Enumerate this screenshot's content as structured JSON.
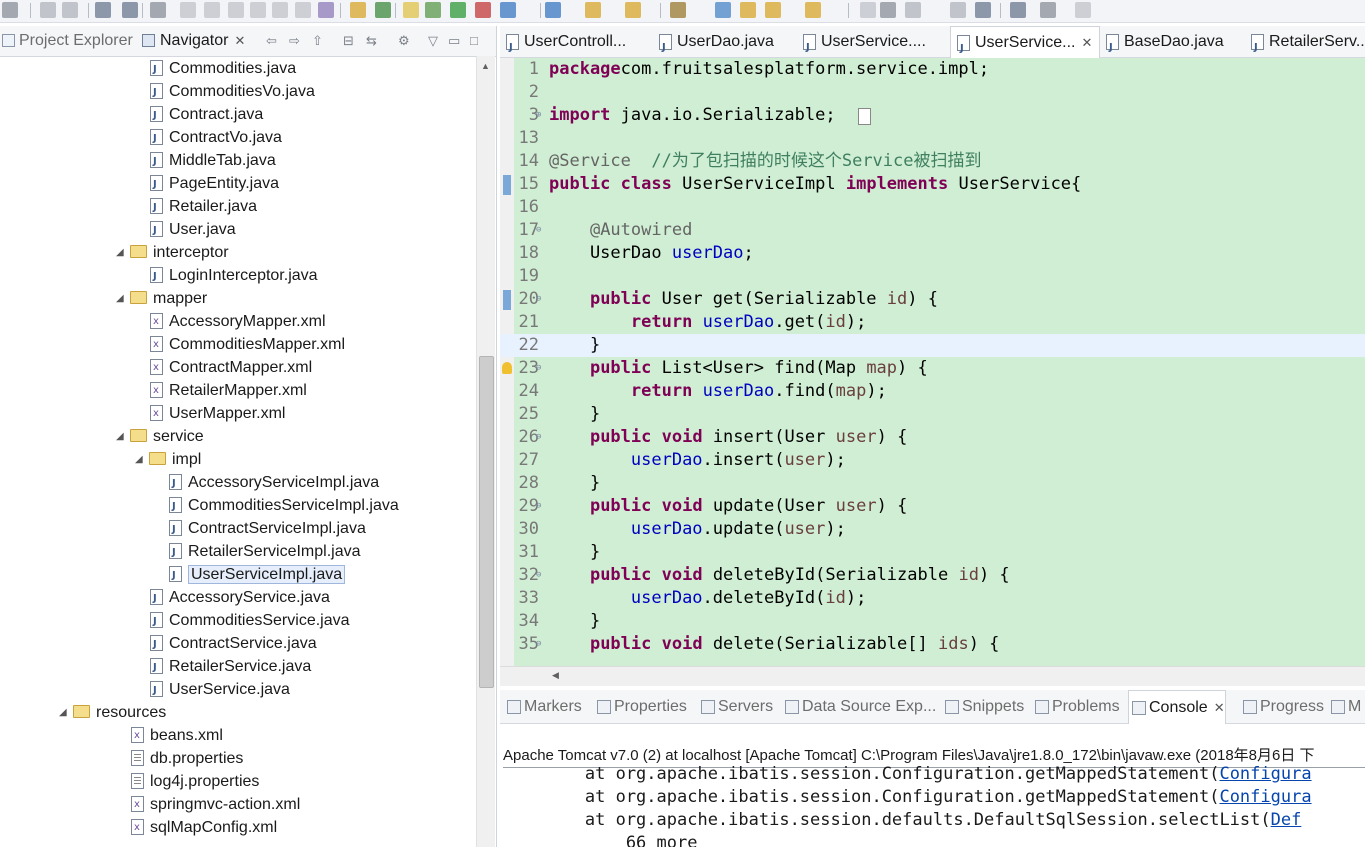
{
  "left_panel": {
    "tabs": [
      {
        "label": "Project Explorer",
        "active": false
      },
      {
        "label": "Navigator",
        "active": true
      }
    ],
    "tree": [
      {
        "label": "Commodities.java",
        "type": "java",
        "depth": 3
      },
      {
        "label": "CommoditiesVo.java",
        "type": "java",
        "depth": 3
      },
      {
        "label": "Contract.java",
        "type": "java",
        "depth": 3
      },
      {
        "label": "ContractVo.java",
        "type": "java",
        "depth": 3
      },
      {
        "label": "MiddleTab.java",
        "type": "java",
        "depth": 3
      },
      {
        "label": "PageEntity.java",
        "type": "java",
        "depth": 3
      },
      {
        "label": "Retailer.java",
        "type": "java",
        "depth": 3
      },
      {
        "label": "User.java",
        "type": "java",
        "depth": 3
      },
      {
        "label": "interceptor",
        "type": "folder",
        "depth": 2,
        "expanded": true
      },
      {
        "label": "LoginInterceptor.java",
        "type": "java",
        "depth": 3
      },
      {
        "label": "mapper",
        "type": "folder",
        "depth": 2,
        "expanded": true
      },
      {
        "label": "AccessoryMapper.xml",
        "type": "xml",
        "depth": 3
      },
      {
        "label": "CommoditiesMapper.xml",
        "type": "xml",
        "depth": 3
      },
      {
        "label": "ContractMapper.xml",
        "type": "xml",
        "depth": 3
      },
      {
        "label": "RetailerMapper.xml",
        "type": "xml",
        "depth": 3
      },
      {
        "label": "UserMapper.xml",
        "type": "xml",
        "depth": 3
      },
      {
        "label": "service",
        "type": "folder",
        "depth": 2,
        "expanded": true
      },
      {
        "label": "impl",
        "type": "folder",
        "depth": 3,
        "expanded": true
      },
      {
        "label": "AccessoryServiceImpl.java",
        "type": "java",
        "depth": 4
      },
      {
        "label": "CommoditiesServiceImpl.java",
        "type": "java",
        "depth": 4
      },
      {
        "label": "ContractServiceImpl.java",
        "type": "java",
        "depth": 4
      },
      {
        "label": "RetailerServiceImpl.java",
        "type": "java",
        "depth": 4
      },
      {
        "label": "UserServiceImpl.java",
        "type": "java",
        "depth": 4,
        "selected": true
      },
      {
        "label": "AccessoryService.java",
        "type": "java",
        "depth": 3
      },
      {
        "label": "CommoditiesService.java",
        "type": "java",
        "depth": 3
      },
      {
        "label": "ContractService.java",
        "type": "java",
        "depth": 3
      },
      {
        "label": "RetailerService.java",
        "type": "java",
        "depth": 3
      },
      {
        "label": "UserService.java",
        "type": "java",
        "depth": 3
      },
      {
        "label": "resources",
        "type": "folder",
        "depth": 1,
        "expanded": true
      },
      {
        "label": "beans.xml",
        "type": "xml",
        "depth": 2
      },
      {
        "label": "db.properties",
        "type": "props",
        "depth": 2
      },
      {
        "label": "log4j.properties",
        "type": "props",
        "depth": 2
      },
      {
        "label": "springmvc-action.xml",
        "type": "xml",
        "depth": 2
      },
      {
        "label": "sqlMapConfig.xml",
        "type": "xml",
        "depth": 2
      }
    ]
  },
  "editor": {
    "tabs": [
      {
        "label": "UserControll...",
        "active": false
      },
      {
        "label": "UserDao.java",
        "active": false
      },
      {
        "label": "UserService....",
        "active": false
      },
      {
        "label": "UserService...",
        "active": true
      },
      {
        "label": "BaseDao.java",
        "active": false
      },
      {
        "label": "RetailerServ...",
        "active": false
      }
    ],
    "lines": [
      {
        "n": "1",
        "parts": [
          [
            "kw",
            "package"
          ],
          [
            "",
            "com.fruitsalesplatform.service.impl;"
          ]
        ]
      },
      {
        "n": "2",
        "parts": []
      },
      {
        "n": "3",
        "fold": "+",
        "parts": [
          [
            "kw",
            "import"
          ],
          [
            "",
            " java.io.Serializable;"
          ]
        ]
      },
      {
        "n": "13",
        "parts": []
      },
      {
        "n": "14",
        "parts": [
          [
            "ann",
            "@Service"
          ],
          [
            "",
            "  "
          ],
          [
            "cmt",
            "//为了包扫描的时候这个Service被扫描到"
          ]
        ]
      },
      {
        "n": "15",
        "parts": [
          [
            "kw",
            "public"
          ],
          [
            "",
            ""
          ],
          [
            "kw",
            "class"
          ],
          [
            "",
            " UserServiceImpl "
          ],
          [
            "kw",
            "implements"
          ],
          [
            "",
            " UserService{"
          ]
        ]
      },
      {
        "n": "16",
        "parts": []
      },
      {
        "n": "17",
        "fold": "-",
        "parts": [
          [
            "",
            "    "
          ],
          [
            "ann",
            "@Autowired"
          ]
        ]
      },
      {
        "n": "18",
        "parts": [
          [
            "",
            "    UserDao "
          ],
          [
            "fld",
            "userDao"
          ],
          [
            "",
            ";"
          ]
        ]
      },
      {
        "n": "19",
        "parts": []
      },
      {
        "n": "20",
        "fold": "-",
        "parts": [
          [
            "",
            "    "
          ],
          [
            "kw",
            "public"
          ],
          [
            "",
            " User get(Serializable "
          ],
          [
            "par",
            "id"
          ],
          [
            "",
            ") {"
          ]
        ]
      },
      {
        "n": "21",
        "parts": [
          [
            "",
            "        "
          ],
          [
            "kw",
            "return"
          ],
          [
            "",
            " "
          ],
          [
            "fld",
            "userDao"
          ],
          [
            "",
            ".get("
          ],
          [
            "par",
            "id"
          ],
          [
            "",
            ");"
          ]
        ]
      },
      {
        "n": "22",
        "current": true,
        "parts": [
          [
            "",
            "    }"
          ]
        ]
      },
      {
        "n": "23",
        "fold": "-",
        "parts": [
          [
            "",
            "    "
          ],
          [
            "kw",
            "public"
          ],
          [
            "",
            " List<User> find(Map "
          ],
          [
            "par",
            "map"
          ],
          [
            "",
            ") {"
          ]
        ]
      },
      {
        "n": "24",
        "parts": [
          [
            "",
            "        "
          ],
          [
            "kw",
            "return"
          ],
          [
            "",
            " "
          ],
          [
            "fld",
            "userDao"
          ],
          [
            "",
            ".find("
          ],
          [
            "par",
            "map"
          ],
          [
            "",
            ");"
          ]
        ]
      },
      {
        "n": "25",
        "parts": [
          [
            "",
            "    }"
          ]
        ]
      },
      {
        "n": "26",
        "fold": "-",
        "parts": [
          [
            "",
            "    "
          ],
          [
            "kw",
            "public"
          ],
          [
            "",
            " "
          ],
          [
            "kw",
            "void"
          ],
          [
            "",
            " insert(User "
          ],
          [
            "par",
            "user"
          ],
          [
            "",
            ") {"
          ]
        ]
      },
      {
        "n": "27",
        "parts": [
          [
            "",
            "        "
          ],
          [
            "fld",
            "userDao"
          ],
          [
            "",
            ".insert("
          ],
          [
            "par",
            "user"
          ],
          [
            "",
            ");"
          ]
        ]
      },
      {
        "n": "28",
        "parts": [
          [
            "",
            "    }"
          ]
        ]
      },
      {
        "n": "29",
        "fold": "-",
        "parts": [
          [
            "",
            "    "
          ],
          [
            "kw",
            "public"
          ],
          [
            "",
            " "
          ],
          [
            "kw",
            "void"
          ],
          [
            "",
            " update(User "
          ],
          [
            "par",
            "user"
          ],
          [
            "",
            ") {"
          ]
        ]
      },
      {
        "n": "30",
        "parts": [
          [
            "",
            "        "
          ],
          [
            "fld",
            "userDao"
          ],
          [
            "",
            ".update("
          ],
          [
            "par",
            "user"
          ],
          [
            "",
            ");"
          ]
        ]
      },
      {
        "n": "31",
        "parts": [
          [
            "",
            "    }"
          ]
        ]
      },
      {
        "n": "32",
        "fold": "-",
        "parts": [
          [
            "",
            "    "
          ],
          [
            "kw",
            "public"
          ],
          [
            "",
            " "
          ],
          [
            "kw",
            "void"
          ],
          [
            "",
            " deleteById(Serializable "
          ],
          [
            "par",
            "id"
          ],
          [
            "",
            ") {"
          ]
        ]
      },
      {
        "n": "33",
        "parts": [
          [
            "",
            "        "
          ],
          [
            "fld",
            "userDao"
          ],
          [
            "",
            ".deleteById("
          ],
          [
            "par",
            "id"
          ],
          [
            "",
            ");"
          ]
        ]
      },
      {
        "n": "34",
        "parts": [
          [
            "",
            "    }"
          ]
        ]
      },
      {
        "n": "35",
        "fold": "-",
        "parts": [
          [
            "",
            "    "
          ],
          [
            "kw",
            "public"
          ],
          [
            "",
            " "
          ],
          [
            "kw",
            "void"
          ],
          [
            "",
            " delete(Serializable[] "
          ],
          [
            "par",
            "ids"
          ],
          [
            "",
            ") {"
          ]
        ]
      }
    ]
  },
  "bottom_panel": {
    "tabs": [
      {
        "label": "Markers",
        "active": false
      },
      {
        "label": "Properties",
        "active": false
      },
      {
        "label": "Servers",
        "active": false
      },
      {
        "label": "Data Source Exp...",
        "active": false
      },
      {
        "label": "Snippets",
        "active": false
      },
      {
        "label": "Problems",
        "active": false
      },
      {
        "label": "Console",
        "active": true
      },
      {
        "label": "Progress",
        "active": false
      },
      {
        "label": "M",
        "active": false
      }
    ],
    "console_header": "Apache Tomcat v7.0 (2) at localhost [Apache Tomcat] C:\\Program Files\\Java\\jre1.8.0_172\\bin\\javaw.exe (2018年8月6日 下",
    "trace": [
      {
        "text": "        at org.apache.ibatis.session.Configuration.getMappedStatement(",
        "link": "Configura"
      },
      {
        "text": "        at org.apache.ibatis.session.Configuration.getMappedStatement(",
        "link": "Configura"
      },
      {
        "text": "        at org.apache.ibatis.session.defaults.DefaultSqlSession.selectList(",
        "link": "Def"
      },
      {
        "text": "            66 more",
        "link": ""
      }
    ]
  }
}
